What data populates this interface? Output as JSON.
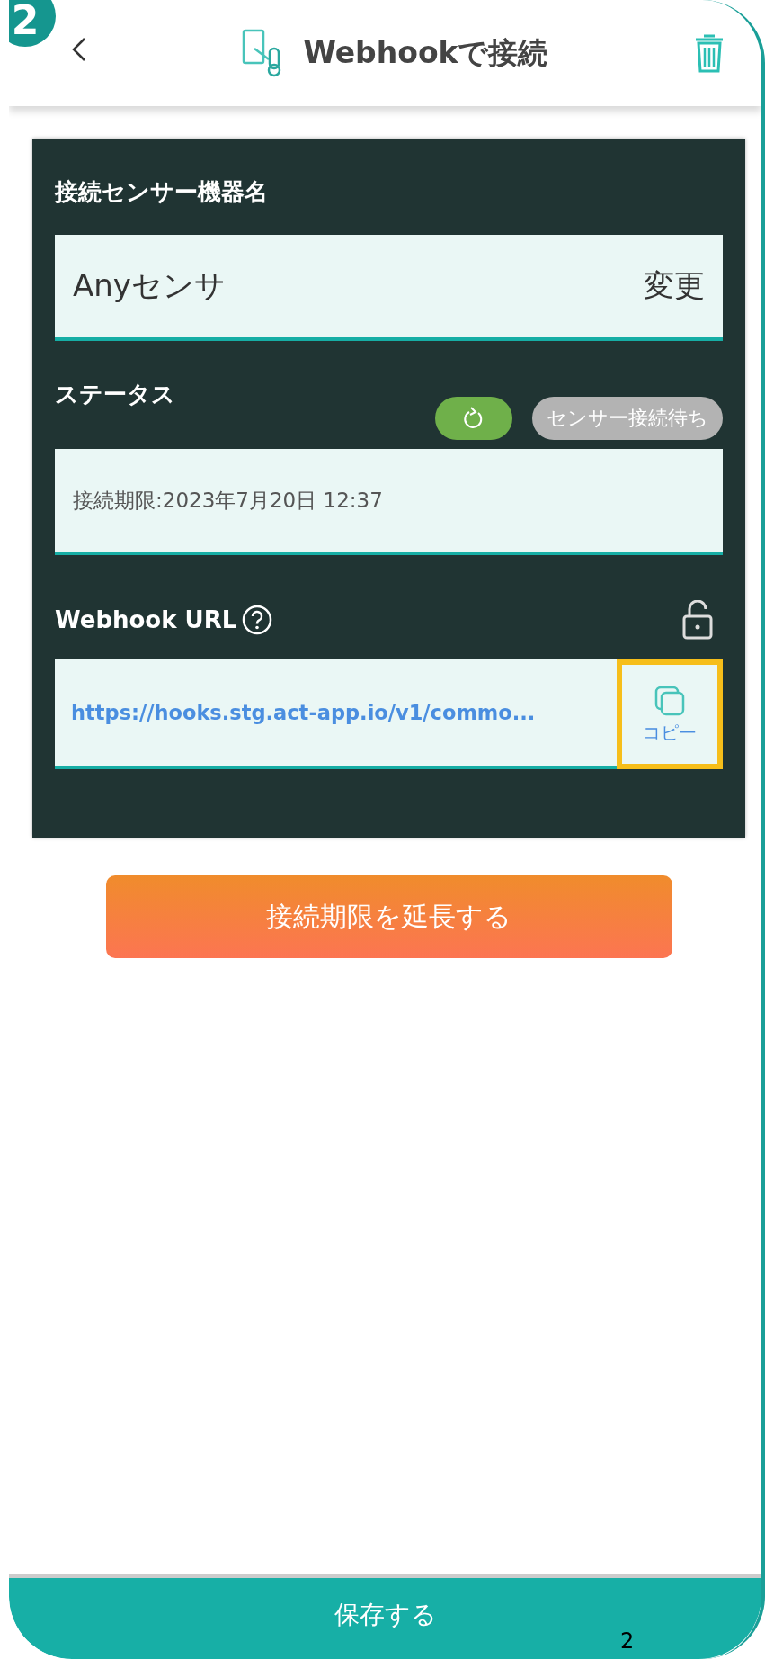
{
  "step_badge": "2",
  "header": {
    "title": "Webhookで接続"
  },
  "sensor_name": {
    "label": "接続センサー機器名",
    "value": "Anyセンサ",
    "action": "変更"
  },
  "status": {
    "label": "ステータス",
    "badge": "センサー接続待ち",
    "expiry": "接続期限:2023年7月20日 12:37"
  },
  "webhook": {
    "label": "Webhook URL",
    "url": "https://hooks.stg.act-app.io/v1/commo...",
    "copy": "コピー",
    "copy_highlighted": true
  },
  "extend_button": "接続期限を延長する",
  "save_button": "保存する",
  "page_number": "2"
}
